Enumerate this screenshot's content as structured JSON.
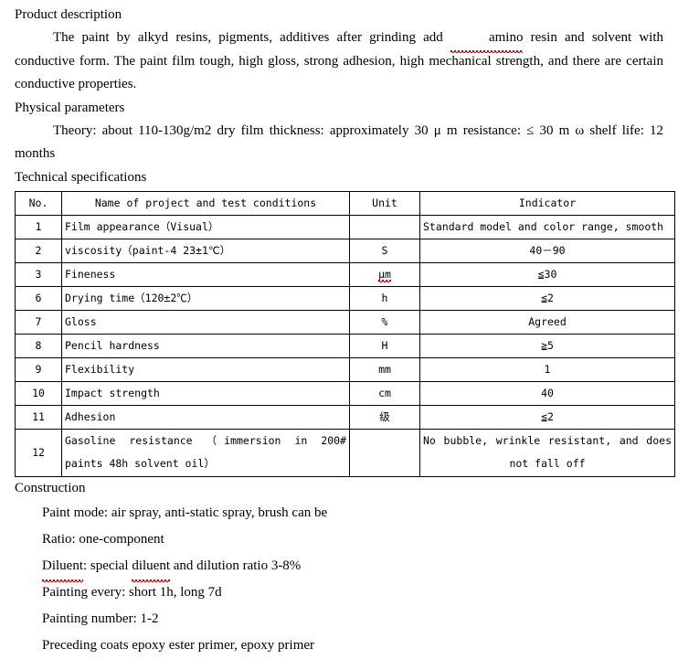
{
  "document": {
    "sections": {
      "product_description_heading": "Product description",
      "product_description_body_1": "The paint by alkyd resins, pigments, additives after grinding add ",
      "product_description_body_amino": "amino",
      "product_description_body_2": " resin and solvent with conductive form. The paint film tough, high gloss, strong adhesion, high mechanical strength, and there are certain conductive properties.",
      "physical_parameters_heading": "Physical parameters",
      "physical_parameters_body": "Theory: about 110-130g/m2 dry film thickness: approximately 30 μ m resistance: ≤ 30 m ω shelf life: 12 months",
      "technical_specifications_heading": "Technical specifications",
      "construction_heading": "Construction"
    },
    "table": {
      "columns": [
        "No.",
        "Name of project and test conditions",
        "Unit",
        "Indicator"
      ],
      "rows": [
        {
          "no": "1",
          "name": "Film appearance（Visual）",
          "unit": "",
          "indicator": "Standard model and color range, smooth"
        },
        {
          "no": "2",
          "name": "viscosity（paint-4 23±1℃）",
          "unit": "S",
          "indicator": "40－90"
        },
        {
          "no": "3",
          "name": "Fineness",
          "unit": "μm",
          "unit_misspelled": true,
          "indicator": "≦30"
        },
        {
          "no": "6",
          "name": "Drying time（120±2℃）",
          "unit": "h",
          "indicator": "≦2"
        },
        {
          "no": "7",
          "name": "Gloss",
          "unit": "%",
          "indicator": "Agreed"
        },
        {
          "no": "8",
          "name": "Pencil hardness",
          "unit": "H",
          "indicator": "≧5"
        },
        {
          "no": "9",
          "name": "Flexibility",
          "unit": "mm",
          "indicator": "1"
        },
        {
          "no": "10",
          "name": "Impact strength",
          "unit": "cm",
          "indicator": "40"
        },
        {
          "no": "11",
          "name": "Adhesion",
          "unit": "级",
          "indicator": "≦2"
        },
        {
          "no": "12",
          "name_line1": "Gasoline resistance （immersion in 200#",
          "name_line2": "paints 48h solvent oil）",
          "unit": "",
          "indicator_line1": "No bubble, wrinkle resistant, and does",
          "indicator_line2": "not fall off"
        }
      ]
    },
    "construction_lines": [
      {
        "text": "Paint mode: air spray, anti-static spray, brush can be"
      },
      {
        "text": "Ratio: one-component"
      },
      {
        "text": "Diluent: special diluent and dilution ratio 3-8%",
        "misspelled": [
          "Diluent",
          "diluent"
        ]
      },
      {
        "text": "Painting every: short 1h, long 7d"
      },
      {
        "text": "Painting number: 1-2"
      },
      {
        "text": "Preceding coats epoxy ester primer, epoxy primer"
      }
    ]
  }
}
